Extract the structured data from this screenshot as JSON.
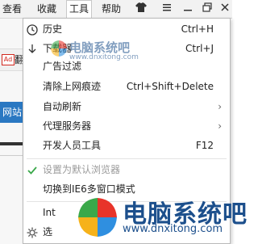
{
  "menubar": {
    "items": [
      {
        "label": "查看"
      },
      {
        "label": "收藏"
      },
      {
        "label": "工具"
      },
      {
        "label": "帮助"
      }
    ]
  },
  "background": {
    "ad_badge": "Ad",
    "ad_text": "翻",
    "blue_text": "网站"
  },
  "menu": {
    "items": [
      {
        "label": "历史",
        "shortcut": "Ctrl+H",
        "icon": "clock-icon"
      },
      {
        "label": "下载器",
        "shortcut": "Ctrl+J",
        "icon": "download-arrow-icon"
      },
      {
        "label": "广告过滤",
        "shortcut": ""
      },
      {
        "label": "清除上网痕迹",
        "shortcut": "Ctrl+Shift+Delete"
      },
      {
        "label": "自动刷新",
        "submenu": true
      },
      {
        "label": "代理服务器",
        "submenu": true
      },
      {
        "label": "开发人员工具",
        "shortcut": "F12"
      },
      {
        "label": "设置为默认浏览器",
        "disabled": true,
        "icon": "check-icon"
      },
      {
        "label": "切换到IE6多窗口模式"
      },
      {
        "label": "Int"
      },
      {
        "label": "选",
        "icon": "gear-icon"
      }
    ]
  },
  "watermark": {
    "title": "电脑系统吧",
    "url": "www.dnxitong.com",
    "title_small": "电脑系统吧",
    "url_small": "www.dnxitong.com"
  },
  "colors": {
    "accent_blue": "#2a78c2",
    "check_green": "#3aa84a",
    "watermark_blue": "#1c4f8c"
  }
}
